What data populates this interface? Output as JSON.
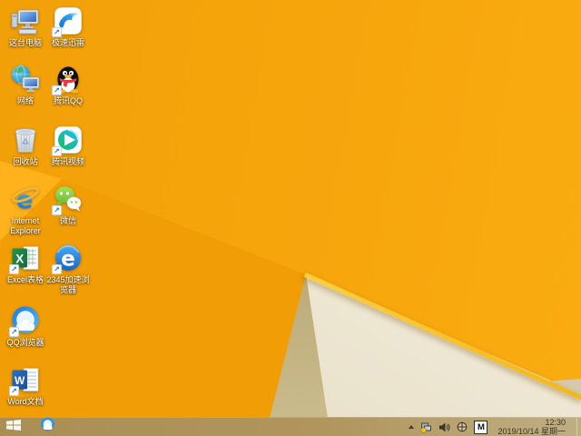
{
  "wallpaper": {
    "base_color": "#f6a50b",
    "highlight_color": "#ffb31c",
    "shadow_color": "#f09d06",
    "ridge_color": "#ffce40",
    "cream_color": "#f2ecdb",
    "olive_color": "#ab965c"
  },
  "desktop": {
    "icons": [
      {
        "name": "this-pc",
        "label": "这台电脑",
        "shortcut": false
      },
      {
        "name": "xunlei-thunder",
        "label": "极速迅雷",
        "shortcut": true
      },
      {
        "name": "network",
        "label": "网络",
        "shortcut": false
      },
      {
        "name": "tencent-qq",
        "label": "腾讯QQ",
        "shortcut": true
      },
      {
        "name": "recycle-bin",
        "label": "回收站",
        "shortcut": false
      },
      {
        "name": "tencent-video",
        "label": "腾讯视频",
        "shortcut": true
      },
      {
        "name": "internet-explorer",
        "label": "Internet Explorer",
        "shortcut": false
      },
      {
        "name": "wechat",
        "label": "微信",
        "shortcut": true
      },
      {
        "name": "excel",
        "label": "Excel表格",
        "shortcut": true
      },
      {
        "name": "2345-browser",
        "label": "2345加速浏览器",
        "shortcut": true
      },
      {
        "name": "qq-browser",
        "label": "QQ浏览器",
        "shortcut": true
      },
      {
        "name": "word",
        "label": "Word文档",
        "shortcut": true
      }
    ],
    "shortcut_arrow_glyph": "↗"
  },
  "taskbar": {
    "tray": {
      "ime": "M",
      "time": "12:30",
      "date": "2019/10/14 星期一"
    }
  }
}
